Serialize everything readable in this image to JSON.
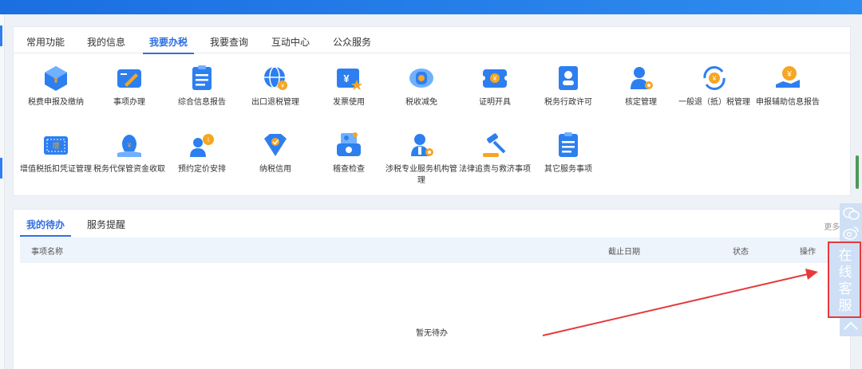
{
  "tabs": [
    {
      "label": "常用功能"
    },
    {
      "label": "我的信息"
    },
    {
      "label": "我要办税"
    },
    {
      "label": "我要查询"
    },
    {
      "label": "互动中心"
    },
    {
      "label": "公众服务"
    }
  ],
  "functions": [
    {
      "label": "税费申报及缴纳",
      "icon": "tax-declare-icon"
    },
    {
      "label": "事项办理",
      "icon": "matter-handle-icon"
    },
    {
      "label": "综合信息报告",
      "icon": "report-icon"
    },
    {
      "label": "出口退税管理",
      "icon": "export-refund-icon"
    },
    {
      "label": "发票使用",
      "icon": "invoice-icon"
    },
    {
      "label": "税收减免",
      "icon": "tax-relief-icon"
    },
    {
      "label": "证明开具",
      "icon": "certificate-icon"
    },
    {
      "label": "税务行政许可",
      "icon": "permit-icon"
    },
    {
      "label": "核定管理",
      "icon": "verify-manage-icon"
    },
    {
      "label": "一般退（抵）税管理",
      "icon": "refund-icon"
    },
    {
      "label": "申报辅助信息报告",
      "icon": "aux-report-icon"
    },
    {
      "label": "增值税抵扣凭证管理",
      "icon": "vat-deduction-icon"
    },
    {
      "label": "税务代保管资金收取",
      "icon": "custody-fund-icon"
    },
    {
      "label": "预约定价安排",
      "icon": "pricing-arrangement-icon"
    },
    {
      "label": "纳税信用",
      "icon": "credit-icon"
    },
    {
      "label": "稽查检查",
      "icon": "inspection-icon"
    },
    {
      "label": "涉税专业服务机构管理",
      "icon": "agency-manage-icon"
    },
    {
      "label": "法律追责与救济事项",
      "icon": "legal-icon"
    },
    {
      "label": "其它服务事项",
      "icon": "other-service-icon"
    }
  ],
  "todo": {
    "tabs": [
      {
        "label": "我的待办"
      },
      {
        "label": "服务提醒"
      }
    ],
    "more": "更多 >",
    "columns": {
      "name": "事项名称",
      "deadline": "截止日期",
      "status": "状态",
      "action": "操作"
    },
    "empty": "暂无待办"
  },
  "sidebar": {
    "customer_service": [
      "在",
      "线",
      "客",
      "服"
    ]
  },
  "colors": {
    "accent": "#2f6fe0",
    "topbar": "#1b6fe0",
    "annotation": "#e53a3a"
  }
}
